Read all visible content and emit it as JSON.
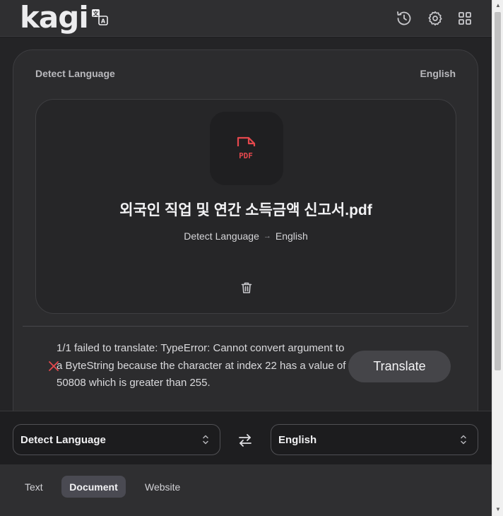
{
  "header": {
    "logo_text": "kagi",
    "icons": [
      "translate-logo-icon",
      "history-icon",
      "gear-icon",
      "grid-icon"
    ]
  },
  "card": {
    "source_label": "Detect Language",
    "target_label": "English",
    "document": {
      "file_icon": "pdf-file-icon",
      "file_name": "외국인 직업 및 연간 소득금액 신고서.pdf",
      "from_language": "Detect Language",
      "arrow": "→",
      "to_language": "English"
    },
    "error": {
      "icon": "close-icon",
      "message": "1/1 failed to translate: TypeError: Cannot convert argument to a ByteString because the character at index 22 has a value of 50808 which is greater than 255."
    },
    "translate_label": "Translate"
  },
  "language_bar": {
    "source_select": "Detect Language",
    "target_select": "English",
    "swap_icon": "swap-icon"
  },
  "tabs": [
    {
      "label": "Text",
      "active": false
    },
    {
      "label": "Document",
      "active": true
    },
    {
      "label": "Website",
      "active": false
    }
  ],
  "colors": {
    "accent_pdf": "#e5484d",
    "background": "#242426",
    "active_tab": "#4a4a52"
  }
}
